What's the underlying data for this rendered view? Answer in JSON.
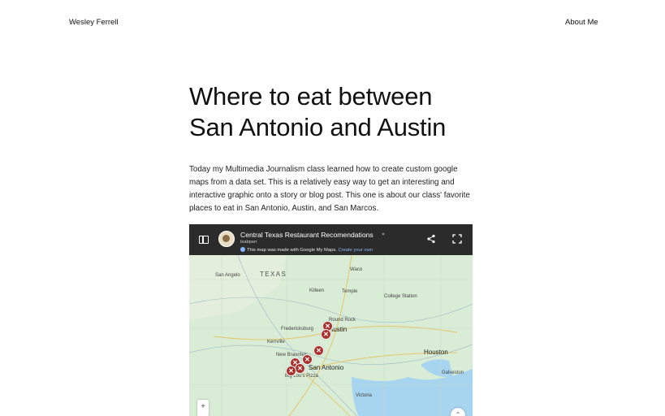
{
  "site": {
    "name": "Wesley Ferrell"
  },
  "nav": {
    "about": "About Me"
  },
  "post": {
    "title": "Where to eat between San Antonio and Austin",
    "body": "Today my Multimedia Journalism class learned how to create custom google maps from a data set. This is a relatively easy way to get an interesting and interactive graphic onto a story or blog post. This one is about our class' favorite places to eat in San Antonio, Austin, and San Marcos."
  },
  "map": {
    "title": "Central Texas Restaurant Recomendations",
    "owner": "tsabparr",
    "notice": "This map was made with Google My Maps.",
    "notice_link": "Create your own",
    "labels": {
      "state": "TEXAS",
      "san_angelo": "San Angelo",
      "waco": "Waco",
      "killeen": "Killeen",
      "temple": "Temple",
      "college_station": "College Station",
      "round_rock": "Round Rock",
      "austin": "Austin",
      "fredericksburg": "Fredericksburg",
      "kerrville": "Kerrville",
      "new_braunfels": "New Braunfels",
      "san_antonio": "San Antonio",
      "big_lou": "Big Lou's Pizza",
      "houston": "Houston",
      "galveston": "Galveston",
      "victoria": "Victoria"
    },
    "pin_glyph": "✕",
    "zoom_glyph": "+",
    "compass_glyph": "⌃",
    "colors": {
      "pin": "#a8322d",
      "land": "#d8ecd6",
      "water": "#a7d4ef",
      "header": "#2b2b2b"
    }
  }
}
